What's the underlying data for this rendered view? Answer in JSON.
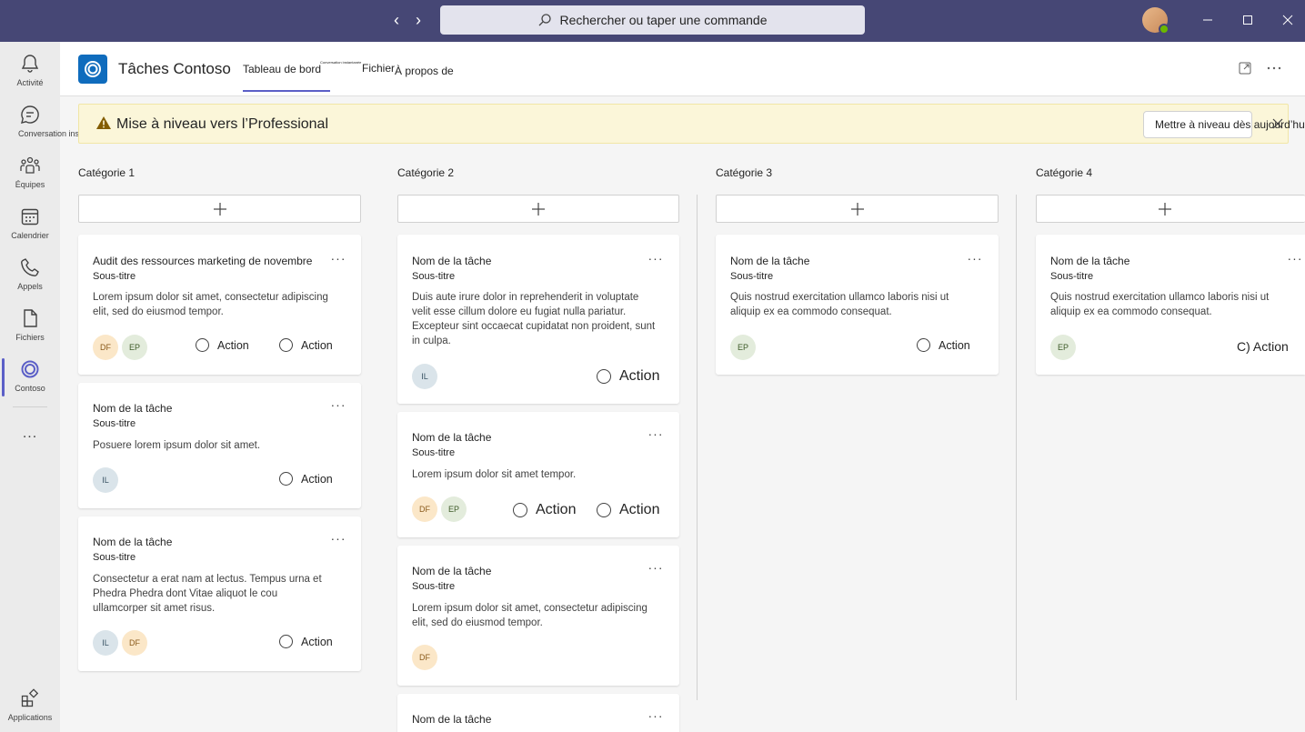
{
  "titlebar": {
    "search_placeholder": "Rechercher ou taper une commande"
  },
  "rail": {
    "items": [
      {
        "label": "Activité",
        "icon": "bell-icon"
      },
      {
        "label": "Conversation instantanée",
        "icon": "chat-icon"
      },
      {
        "label": "Équipes",
        "icon": "teams-icon"
      },
      {
        "label": "Calendrier",
        "icon": "calendar-icon"
      },
      {
        "label": "Appels",
        "icon": "phone-icon"
      },
      {
        "label": "Fichiers",
        "icon": "file-icon"
      },
      {
        "label": "Contoso",
        "icon": "contoso-icon"
      }
    ],
    "more": "...",
    "apps_label": "Applications"
  },
  "app": {
    "title": "Tâches Contoso",
    "tabs": [
      {
        "label": "Tableau de bord"
      },
      {
        "label": "Conversation instantanée"
      },
      {
        "label": "Fichier"
      },
      {
        "label": "À propos de"
      }
    ]
  },
  "banner": {
    "text": "Mise à niveau vers l’Professional",
    "button": "Mettre à niveau dès aujourd’hui"
  },
  "board": {
    "columns": [
      {
        "title": "Catégorie 1",
        "cards": [
          {
            "title": "Audit des ressources marketing de novembre",
            "subtitle": "Sous-titre",
            "body": [
              "Lorem ipsum dolor sit amet, consectetur adipiscing",
              "elit, sed do eiusmod tempor."
            ],
            "avatars": [
              "DF",
              "EP"
            ],
            "actions": [
              "Action",
              "Action"
            ]
          },
          {
            "title": "Nom de la tâche",
            "subtitle": "Sous-titre",
            "body": [
              "Posuere lorem ipsum dolor sit amet."
            ],
            "avatars": [
              "IL"
            ],
            "actions": [
              "Action"
            ]
          },
          {
            "title": "Nom de la tâche",
            "subtitle": "Sous-titre",
            "body": [
              "Consectetur a erat nam at lectus. Tempus urna et",
              "Phedra Phedra dont Vitae aliquot le cou",
              "ullamcorper sit amet risus."
            ],
            "avatars": [
              "IL",
              "DF"
            ],
            "actions": [
              "Action"
            ]
          }
        ]
      },
      {
        "title": "Catégorie 2",
        "cards": [
          {
            "title": "Nom de la tâche",
            "subtitle": "Sous-titre",
            "body": [
              "Duis aute irure dolor in reprehenderit in voluptate",
              "velit esse cillum dolore eu fugiat nulla pariatur.",
              "Excepteur sint occaecat cupidatat non proident, sunt",
              "in culpa."
            ],
            "avatars": [
              "IL"
            ],
            "actions": [
              "Action"
            ]
          },
          {
            "title": "Nom de la tâche",
            "subtitle": "Sous-titre",
            "body": [
              "Lorem ipsum dolor sit amet tempor."
            ],
            "avatars": [
              "DF",
              "EP"
            ],
            "actions": [
              "Action",
              "Action"
            ]
          },
          {
            "title": "Nom de la tâche",
            "subtitle": "Sous-titre",
            "body": [
              "Lorem ipsum dolor sit amet, consectetur adipiscing",
              "elit, sed do eiusmod tempor."
            ],
            "avatars": [
              "DF"
            ],
            "actions": []
          },
          {
            "title": "Nom de la tâche",
            "subtitle": "",
            "body": [],
            "avatars": [],
            "actions": []
          }
        ]
      },
      {
        "title": "Catégorie 3",
        "cards": [
          {
            "title": "Nom de la tâche",
            "subtitle": "Sous-titre",
            "body": [
              "Quis nostrud exercitation ullamco laboris nisi ut",
              "aliquip ex ea commodo consequat."
            ],
            "avatars": [
              "EP"
            ],
            "actions": [
              "Action"
            ]
          }
        ]
      },
      {
        "title": "Catégorie 4",
        "cards": [
          {
            "title": "Nom de la tâche",
            "subtitle": "Sous-titre",
            "body": [
              "Quis nostrud exercitation ullamco laboris nisi ut",
              "aliquip ex ea commodo consequat."
            ],
            "avatars": [
              "EP"
            ],
            "actions": [
              "C) Action"
            ]
          }
        ]
      }
    ]
  },
  "colors": {
    "titlebar": "#464775",
    "accent": "#5b5fc7",
    "banner_bg": "#fbf6d9",
    "app_logo": "#0f6cbd"
  }
}
